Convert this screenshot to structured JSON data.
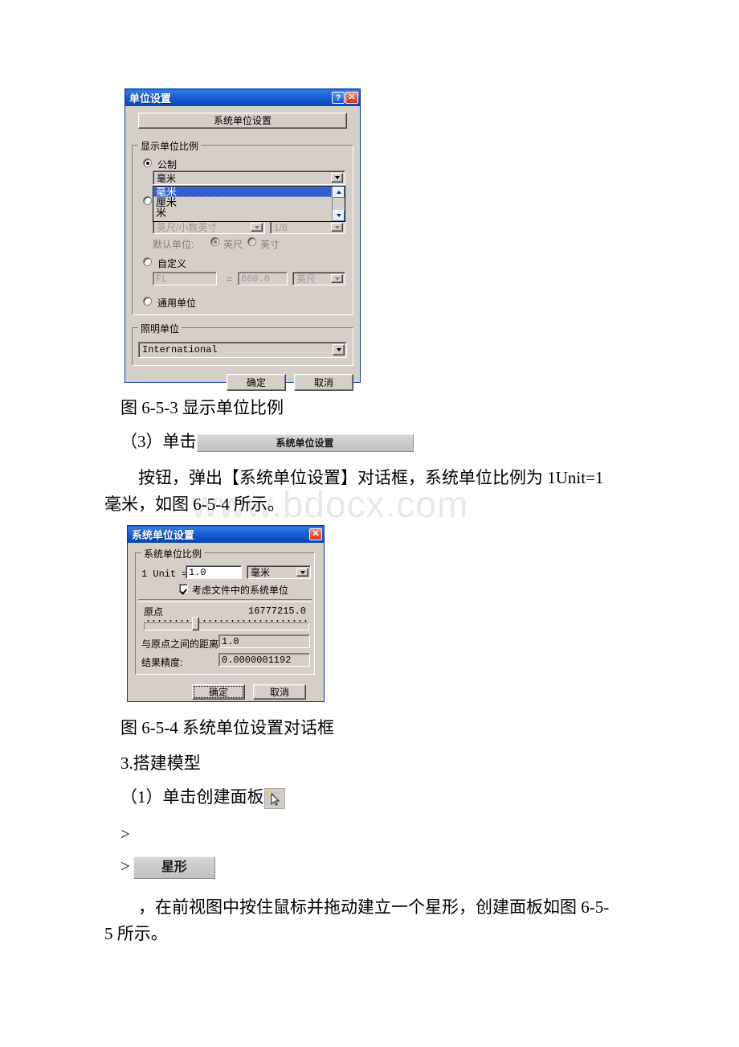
{
  "page": {
    "watermark": "www.bdocx.com"
  },
  "dialog_display_units": {
    "title": "单位设置",
    "help_glyph": "?",
    "close_glyph": "✕",
    "system_unit_button": "系统单位设置",
    "display_group_legend": "显示单位比例",
    "metric_radio_label": "公制",
    "metric_combo_value": "毫米",
    "metric_dropdown_open": true,
    "metric_dropdown_options": [
      "毫米",
      "厘米",
      "米"
    ],
    "metric_dropdown_selected": "毫米",
    "us_standard_combo_value": "英尺/小数英寸",
    "us_standard_fraction_value": "1/8",
    "default_unit_label": "默认单位:",
    "default_unit_feet": "英尺",
    "default_unit_inch": "英寸",
    "custom_radio_label": "自定义",
    "custom_name_value": "FL",
    "custom_equals": "=",
    "custom_value": "660.0",
    "custom_unit_value": "英尺",
    "generic_radio_label": "通用单位",
    "lighting_group_legend": "照明单位",
    "lighting_combo_value": "International",
    "ok_button": "确定",
    "cancel_button": "取消"
  },
  "caption_653": "图 6-5-3 显示单位比例",
  "step3_prefix": "（3）单击",
  "step3_button_label": "系统单位设置",
  "para_after_step3_line1": "按钮，弹出【系统单位设置】对话框，系统单位比例为 1Unit=1",
  "para_after_step3_line2": "毫米，如图 6-5-4 所示。",
  "dialog_system_units": {
    "title": "系统单位设置",
    "close_glyph": "✕",
    "group_legend": "系统单位比例",
    "unit_prefix": "1 Unit =",
    "unit_value": "1.0",
    "unit_combo_value": "毫米",
    "consider_file_units_label": "考虑文件中的系统单位",
    "consider_file_units_checked": true,
    "origin_label": "原点",
    "origin_value": "16777215.0",
    "distance_label": "与原点之间的距离:",
    "distance_value": "1.0",
    "precision_label": "结果精度:",
    "precision_value": "0.0000001192",
    "ok_button": "确定",
    "cancel_button": "取消"
  },
  "caption_654": "图 6-5-4 系统单位设置对话框",
  "heading_3": "3.搭建模型",
  "step1_prefix": "（1）单击创建面板",
  "cursor_icon_name": "arrow-cursor-icon",
  "arrow_line_1": ">",
  "arrow_line_2": ">",
  "star_button_label": "星形",
  "para_tail_line1": "，在前视图中按住鼠标并拖动建立一个星形，创建面板如图 6-5-",
  "para_tail_line2": "5 所示。"
}
